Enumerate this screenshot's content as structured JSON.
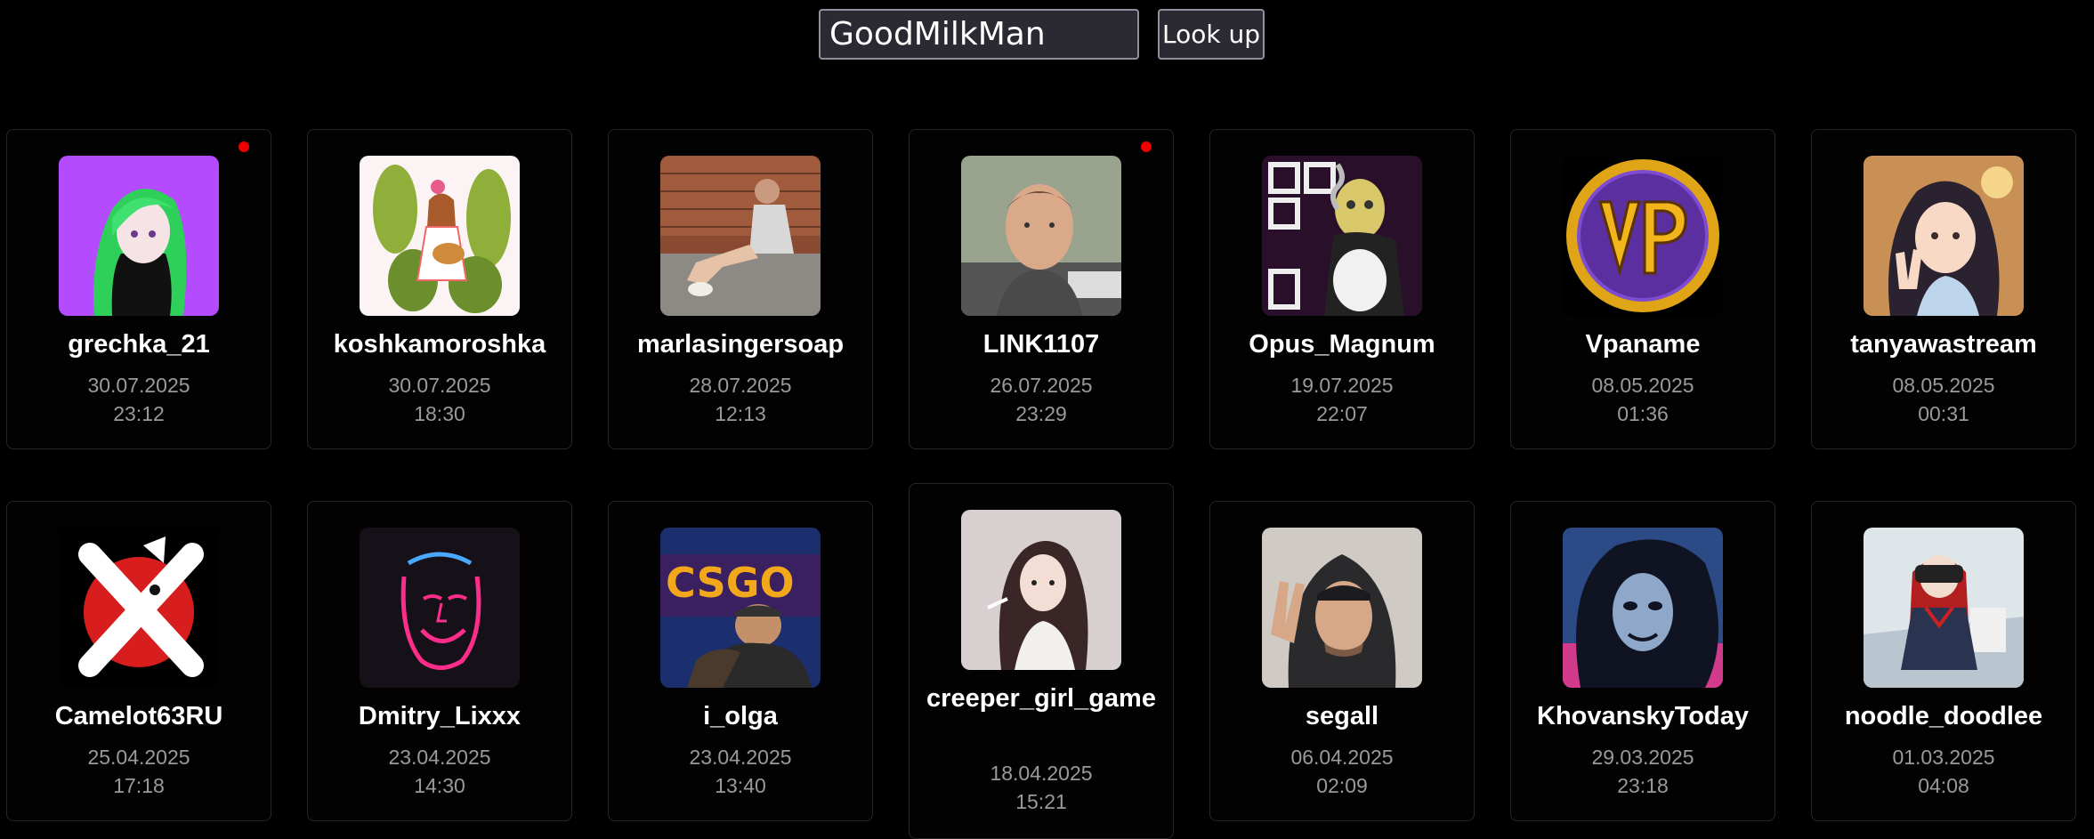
{
  "search": {
    "value": "GoodMilkMan",
    "button_label": "Look up"
  },
  "channels": [
    {
      "name": "grechka_21",
      "date": "30.07.2025",
      "time": "23:12",
      "live": true,
      "avatar": "anime-girl-green-hair"
    },
    {
      "name": "koshkamoroshka",
      "date": "30.07.2025",
      "time": "18:30",
      "live": false,
      "avatar": "illustration-guitar-girl"
    },
    {
      "name": "marlasingersoap",
      "date": "28.07.2025",
      "time": "12:13",
      "live": false,
      "avatar": "photo-woman-sitting"
    },
    {
      "name": "LINK1107",
      "date": "26.07.2025",
      "time": "23:29",
      "live": true,
      "avatar": "photo-man-portrait"
    },
    {
      "name": "Opus_Magnum",
      "date": "19.07.2025",
      "time": "22:07",
      "live": false,
      "avatar": "cartoon-smoking-character"
    },
    {
      "name": "Vpaname",
      "date": "08.05.2025",
      "time": "01:36",
      "live": false,
      "avatar": "vp-gold-logo"
    },
    {
      "name": "tanyawastream",
      "date": "08.05.2025",
      "time": "00:31",
      "live": false,
      "avatar": "anime-girl-peace-sign"
    },
    {
      "name": "Camelot63RU",
      "date": "25.04.2025",
      "time": "17:18",
      "live": false,
      "avatar": "red-x-cat-logo"
    },
    {
      "name": "Dmitry_Lixxx",
      "date": "23.04.2025",
      "time": "14:30",
      "live": false,
      "avatar": "neon-face"
    },
    {
      "name": "i_olga",
      "date": "23.04.2025",
      "time": "13:40",
      "live": false,
      "avatar": "csgo-man-photo"
    },
    {
      "name": "creeper_girl_game",
      "date": "18.04.2025",
      "time": "15:21",
      "live": false,
      "avatar": "anime-girl-dark-hair"
    },
    {
      "name": "segall",
      "date": "06.04.2025",
      "time": "02:09",
      "live": false,
      "avatar": "photo-man-hood"
    },
    {
      "name": "KhovanskyToday",
      "date": "29.03.2025",
      "time": "23:18",
      "live": false,
      "avatar": "dark-fantasy-face"
    },
    {
      "name": "noodle_doodlee",
      "date": "01.03.2025",
      "time": "04:08",
      "live": false,
      "avatar": "3d-schoolgirl-vr"
    }
  ]
}
